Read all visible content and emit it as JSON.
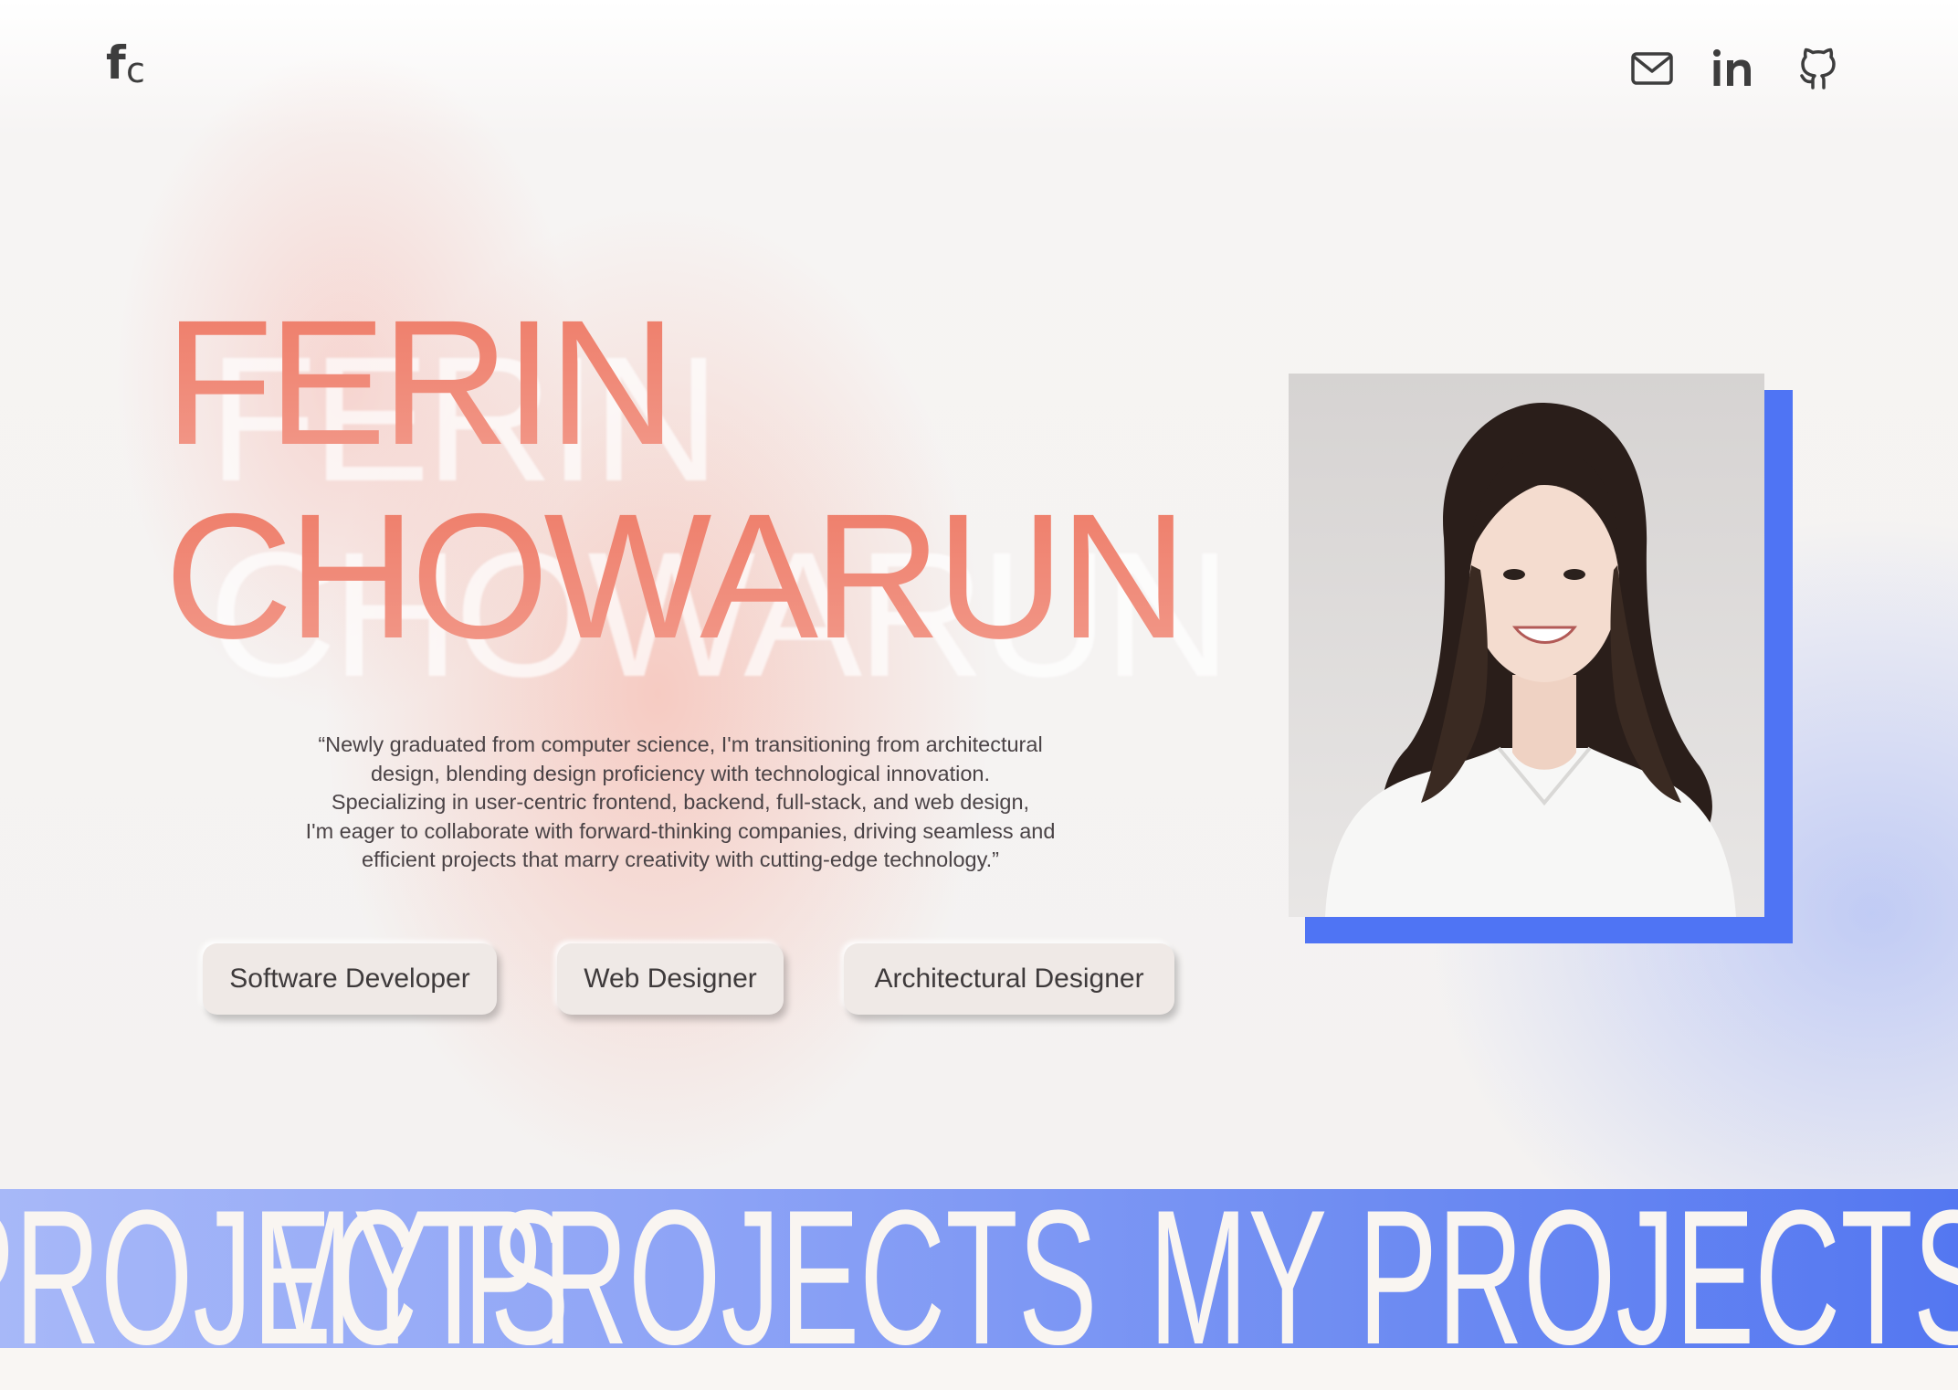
{
  "header": {
    "logo_f": "f",
    "logo_c": "c",
    "icons": [
      "mail-icon",
      "linkedin-icon",
      "github-icon"
    ]
  },
  "hero": {
    "first_name": "FERIN",
    "last_name": "CHOWARUN",
    "quote_lines": [
      "“Newly graduated from computer science, I'm transitioning from architectural",
      "design, blending design proficiency with technological innovation.",
      "Specializing in user-centric frontend, backend, full-stack, and web design,",
      "I'm eager to collaborate with forward-thinking companies, driving seamless and",
      "efficient projects that marry creativity with cutting-edge technology.”"
    ],
    "roles": [
      "Software Developer",
      "Web Designer",
      "Architectural Designer"
    ]
  },
  "banner": {
    "text": "MY PROJECTS"
  },
  "colors": {
    "name_accent": "#ee7c68",
    "photo_frame": "#4f74f4",
    "banner_start": "#a7b8f8",
    "banner_end": "#5477f1",
    "banner_text": "#f9f5f1"
  }
}
